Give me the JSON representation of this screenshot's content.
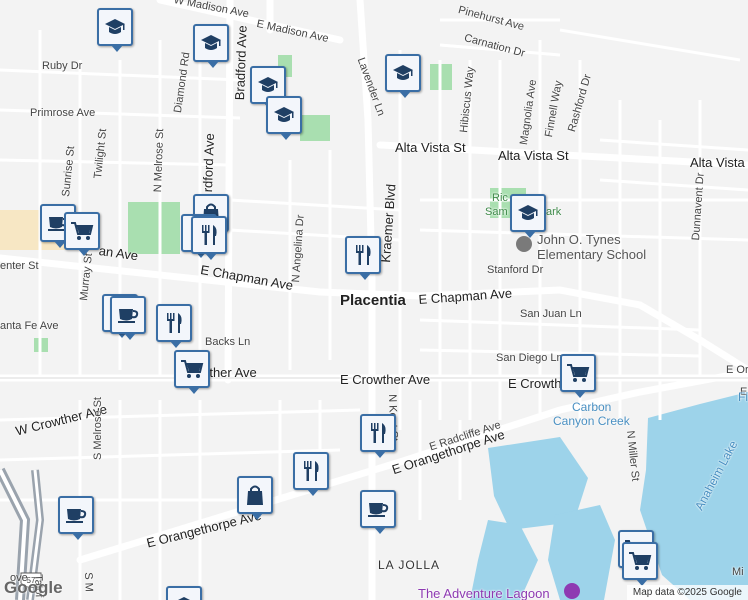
{
  "city": "Placentia",
  "area": "LA JOLLA",
  "school": {
    "line1": "John O. Tynes",
    "line2": "Elementary School"
  },
  "parks": {
    "rick_part1": "Ric",
    "rick_part2": "Sam",
    "rick_part3": "ark"
  },
  "water": {
    "carbon_line1": "Carbon",
    "carbon_line2": "Canyon Creek",
    "lake": "Anaheim Lake"
  },
  "attraction": "The Adventure Lagoon",
  "streets": {
    "w_madison": "W Madison Ave",
    "e_madison": "E Madison Ave",
    "pinehurst": "Pinehurst Ave",
    "carnation": "Carnation Dr",
    "ruby": "Ruby Dr",
    "primrose": "Primrose Ave",
    "alta_vista_1": "Alta Vista St",
    "alta_vista_2": "Alta Vista St",
    "alta_vista_3": "Alta Vista",
    "chapman_w": "E Chapman Ave",
    "chapman_e": "E Chapman Ave",
    "chapman_frag": "an Ave",
    "center": "enter St",
    "santa_fe": "anta Fe Ave",
    "backs": "Backs Ln",
    "crowther_w": "W Crowther Ave",
    "crowther_e": "E Crowther Ave",
    "crowther_frag": "rther Ave",
    "crowther_far": "E Crowth",
    "orangethorpe_1": "E Orangethorpe Ave",
    "orangethorpe_2": "E Orangethorpe Ave",
    "radcliffe": "E Radcliffe Ave",
    "stanford": "Stanford Dr",
    "san_juan": "San Juan Ln",
    "san_diego": "San Diego Ln",
    "bradford": "Bradford Ave",
    "bradford_frag": "rdford Ave",
    "diamond": "Diamond Rd",
    "melrose_n": "N Melrose St",
    "melrose_s": "S Melrose St",
    "twilight": "Twilight St",
    "sunrise": "Sunrise St",
    "murray": "Murray St",
    "angelina": "N Angelina Dr",
    "kraemer": "Kraemer Blvd",
    "lavender": "Lavender Ln",
    "hibiscus": "Hibiscus Way",
    "magnolia": "Magnolia Ave",
    "finnell": "Finnell Way",
    "rashford": "Rashford Dr",
    "dunnavent": "Dunnavent Dr",
    "miller": "N Miller St",
    "kent": "N Kent St",
    "n_frag": "N",
    "s_frag": "S M",
    "talof": "Talof",
    "grove": "ove",
    "mi_frag": "Mi",
    "e_ora_frag": "E Ora",
    "e_frag": "E",
    "fi_frag": "Fi",
    "hwy": "57"
  },
  "brand": "Google",
  "attribution": "Map data ©2025 Google",
  "colors": {
    "pin_border": "#3a6ea5",
    "water": "#9dd3ea",
    "park": "#a9dfb0",
    "road": "#ffffff"
  },
  "markers": [
    {
      "icon": "school"
    },
    {
      "icon": "school"
    },
    {
      "icon": "school"
    },
    {
      "icon": "school"
    },
    {
      "icon": "school"
    },
    {
      "icon": "school"
    },
    {
      "icon": "cafe"
    },
    {
      "icon": "shopping-cart"
    },
    {
      "icon": "shopping-bag"
    },
    {
      "icon": "restaurant"
    },
    {
      "icon": "restaurant"
    },
    {
      "icon": "restaurant"
    },
    {
      "icon": "cafe"
    },
    {
      "icon": "restaurant"
    },
    {
      "icon": "shopping-cart"
    },
    {
      "icon": "shopping-cart"
    },
    {
      "icon": "restaurant"
    },
    {
      "icon": "restaurant"
    },
    {
      "icon": "shopping-bag"
    },
    {
      "icon": "cafe"
    },
    {
      "icon": "cafe"
    },
    {
      "icon": "shopping-cart"
    },
    {
      "icon": "shopping-cart"
    },
    {
      "icon": "school"
    },
    {
      "icon": "cafe"
    }
  ]
}
